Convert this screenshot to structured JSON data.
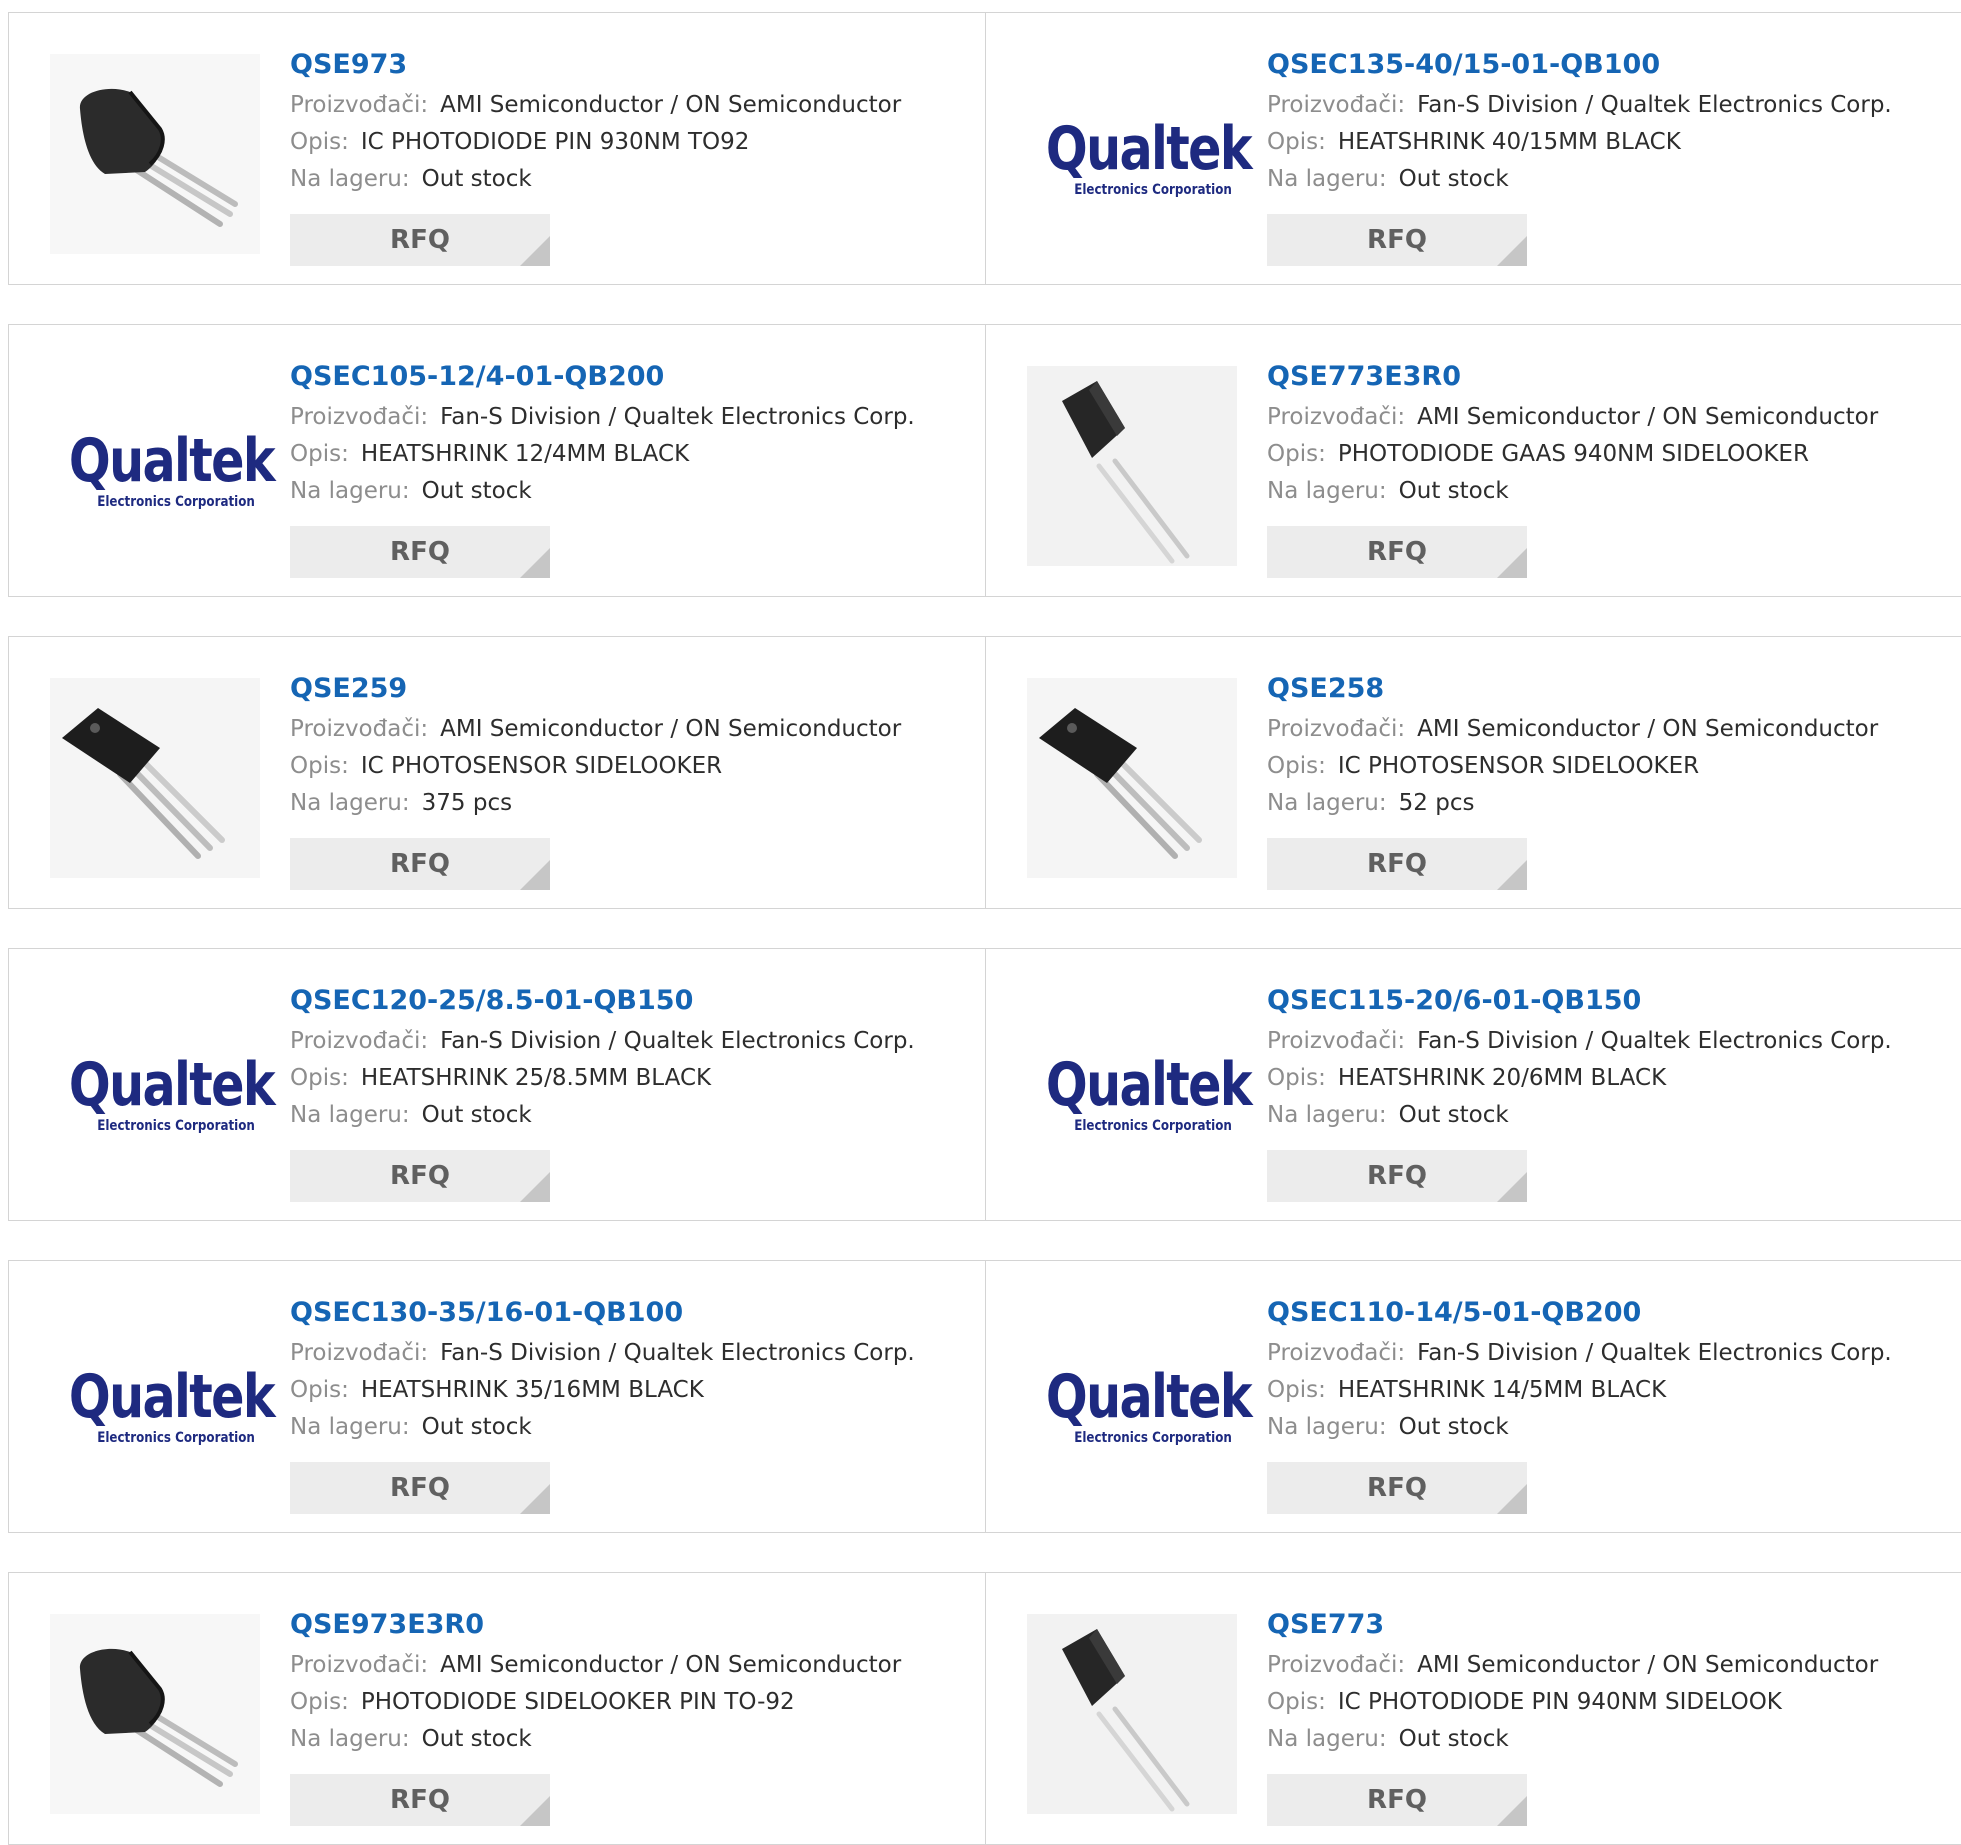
{
  "labels": {
    "manufacturer": "Proizvođači:",
    "description": "Opis:",
    "stock": "Na lageru:",
    "rfq": "RFQ"
  },
  "logo": {
    "word": "Qualtek",
    "sub": "Electronics Corporation"
  },
  "colors": {
    "part_link": "#1565b4",
    "label": "#8d8d8d",
    "value": "#2d2d2d",
    "button_bg": "#ececec",
    "border": "#d4d4d4",
    "qualtek_brand": "#1e2a80"
  },
  "rows": [
    [
      {
        "part": "QSE973",
        "manufacturer": "AMI Semiconductor / ON Semiconductor",
        "description": "IC PHOTODIODE PIN 930NM TO92",
        "stock": "Out stock",
        "image": "to92-icon"
      },
      {
        "part": "QSEC135-40/15-01-QB100",
        "manufacturer": "Fan-S Division / Qualtek Electronics Corp.",
        "description": "HEATSHRINK 40/15MM BLACK",
        "stock": "Out stock",
        "image": "qualtek-logo"
      }
    ],
    [
      {
        "part": "QSEC105-12/4-01-QB200",
        "manufacturer": "Fan-S Division / Qualtek Electronics Corp.",
        "description": "HEATSHRINK 12/4MM BLACK",
        "stock": "Out stock",
        "image": "qualtek-logo"
      },
      {
        "part": "QSE773E3R0",
        "manufacturer": "AMI Semiconductor / ON Semiconductor",
        "description": "PHOTODIODE GAAS 940NM SIDELOOKER",
        "stock": "Out stock",
        "image": "sidelooker-icon"
      }
    ],
    [
      {
        "part": "QSE259",
        "manufacturer": "AMI Semiconductor / ON Semiconductor",
        "description": "IC PHOTOSENSOR SIDELOOKER",
        "stock": "375 pcs",
        "image": "photosensor-icon"
      },
      {
        "part": "QSE258",
        "manufacturer": "AMI Semiconductor / ON Semiconductor",
        "description": "IC PHOTOSENSOR SIDELOOKER",
        "stock": "52 pcs",
        "image": "photosensor-icon"
      }
    ],
    [
      {
        "part": "QSEC120-25/8.5-01-QB150",
        "manufacturer": "Fan-S Division / Qualtek Electronics Corp.",
        "description": "HEATSHRINK 25/8.5MM BLACK",
        "stock": "Out stock",
        "image": "qualtek-logo"
      },
      {
        "part": "QSEC115-20/6-01-QB150",
        "manufacturer": "Fan-S Division / Qualtek Electronics Corp.",
        "description": "HEATSHRINK 20/6MM BLACK",
        "stock": "Out stock",
        "image": "qualtek-logo"
      }
    ],
    [
      {
        "part": "QSEC130-35/16-01-QB100",
        "manufacturer": "Fan-S Division / Qualtek Electronics Corp.",
        "description": "HEATSHRINK 35/16MM BLACK",
        "stock": "Out stock",
        "image": "qualtek-logo"
      },
      {
        "part": "QSEC110-14/5-01-QB200",
        "manufacturer": "Fan-S Division / Qualtek Electronics Corp.",
        "description": "HEATSHRINK 14/5MM BLACK",
        "stock": "Out stock",
        "image": "qualtek-logo"
      }
    ],
    [
      {
        "part": "QSE973E3R0",
        "manufacturer": "AMI Semiconductor / ON Semiconductor",
        "description": "PHOTODIODE SIDELOOKER PIN TO-92",
        "stock": "Out stock",
        "image": "to92-icon"
      },
      {
        "part": "QSE773",
        "manufacturer": "AMI Semiconductor / ON Semiconductor",
        "description": "IC PHOTODIODE PIN 940NM SIDELOOK",
        "stock": "Out stock",
        "image": "sidelooker-icon"
      }
    ]
  ]
}
